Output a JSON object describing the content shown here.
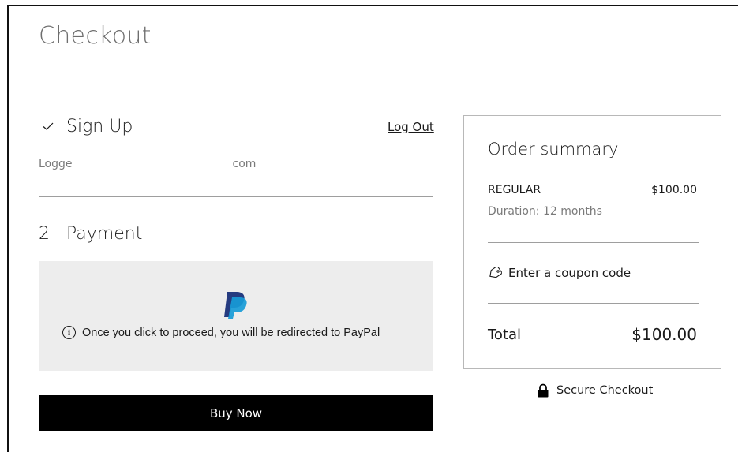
{
  "page": {
    "title": "Checkout"
  },
  "signup": {
    "title": "Sign Up",
    "logout_label": "Log Out",
    "logged_in_prefix": "Logge",
    "logged_in_suffix": "com"
  },
  "payment": {
    "step_number": "2",
    "title": "Payment",
    "provider_icon": "paypal-logo",
    "redirect_notice": "Once you click to proceed, you will be redirected to PayPal",
    "buy_label": "Buy Now"
  },
  "summary": {
    "title": "Order summary",
    "item_name": "REGULAR",
    "item_price": "$100.00",
    "item_duration": "Duration: 12 months",
    "coupon_label": "Enter a coupon code",
    "total_label": "Total",
    "total_value": "$100.00"
  },
  "footer": {
    "secure_label": "Secure Checkout"
  },
  "colors": {
    "accent": "#000000",
    "paypal_dark": "#253b80",
    "paypal_light": "#179bd7",
    "panel_bg": "#ededed"
  }
}
